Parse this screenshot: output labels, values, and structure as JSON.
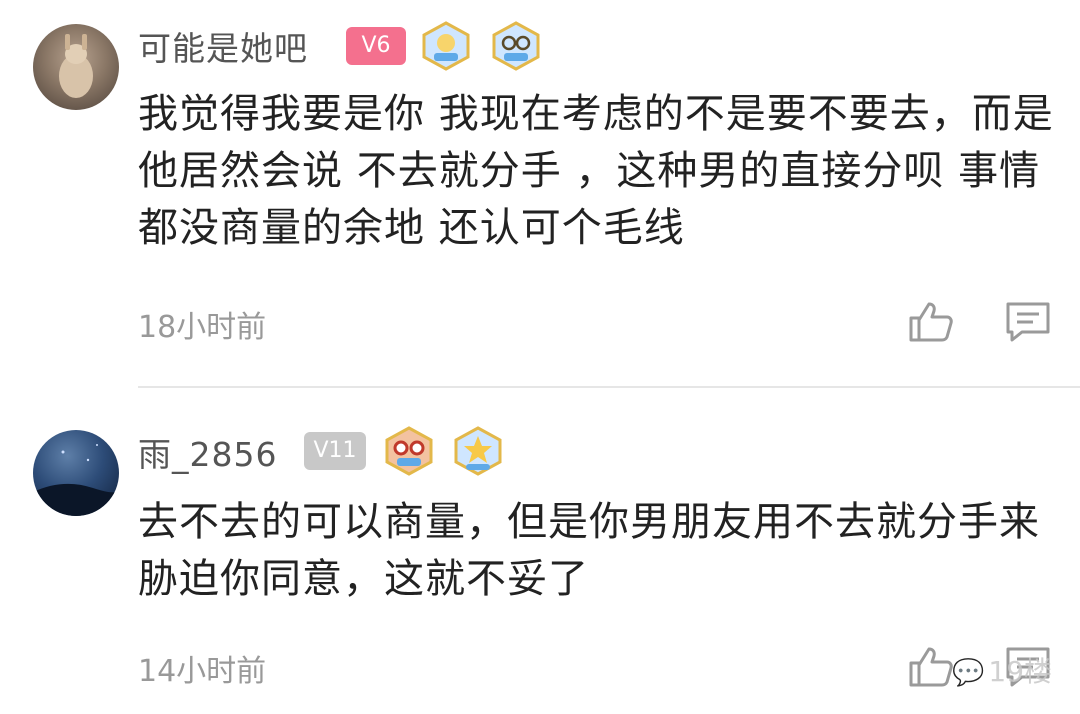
{
  "comments": [
    {
      "username": "可能是她吧",
      "level": "V6",
      "text": "我觉得我要是你 我现在考虑的不是要不要去，而是他居然会说 不去就分手 ，这种男的直接分呗 事情都没商量的余地 还认可个毛线",
      "time": "18小时前"
    },
    {
      "username": "雨_2856",
      "level": "V11",
      "text": "去不去的可以商量，但是你男朋友用不去就分手来胁迫你同意，这就不妥了",
      "time": "14小时前"
    }
  ],
  "watermark": {
    "label": "19楼"
  },
  "colors": {
    "level_badge_v6": "#f4708e",
    "level_badge_v11": "#c8c8c8",
    "divider": "#e6e6e6"
  },
  "icons": [
    "like-icon",
    "reply-icon",
    "medal-icon",
    "wechat-icon"
  ]
}
